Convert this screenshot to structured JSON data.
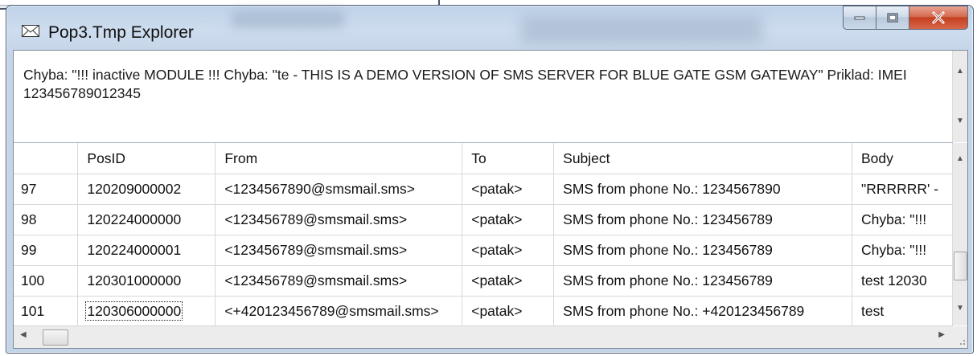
{
  "window": {
    "title": "Pop3.Tmp  Explorer",
    "icon": "envelope-icon"
  },
  "controls": {
    "minimize": "minimize-icon",
    "maximize": "maximize-icon",
    "close": "close-icon"
  },
  "message_text": "Chyba: \"!!! inactive MODULE !!! Chyba: \"te - THIS IS A DEMO VERSION OF SMS SERVER FOR BLUE GATE GSM GATEWAY\"  Priklad: IMEI 123456789012345",
  "grid": {
    "columns": [
      "",
      "PosID",
      "From",
      "To",
      "Subject",
      "Body"
    ],
    "rows": [
      [
        "97",
        "120209000002",
        "<1234567890@smsmail.sms>",
        "<patak>",
        "SMS from phone No.: 1234567890",
        "\"RRRRRR' -"
      ],
      [
        "98",
        "120224000000",
        "<123456789@smsmail.sms>",
        "<patak>",
        "SMS from phone No.: 123456789",
        "Chyba: \"!!!"
      ],
      [
        "99",
        "120224000001",
        "<123456789@smsmail.sms>",
        "<patak>",
        "SMS from phone No.: 123456789",
        "Chyba: \"!!!"
      ],
      [
        "100",
        "120301000000",
        "<123456789@smsmail.sms>",
        "<patak>",
        "SMS from phone No.: 123456789",
        "test 12030"
      ],
      [
        "101",
        "120306000000",
        "<+420123456789@smsmail.sms>",
        "<patak>",
        "SMS from phone No.: +420123456789",
        "test"
      ]
    ]
  },
  "colors": {
    "titlebar": "#c5d5e8",
    "close_button": "#c4401f"
  }
}
